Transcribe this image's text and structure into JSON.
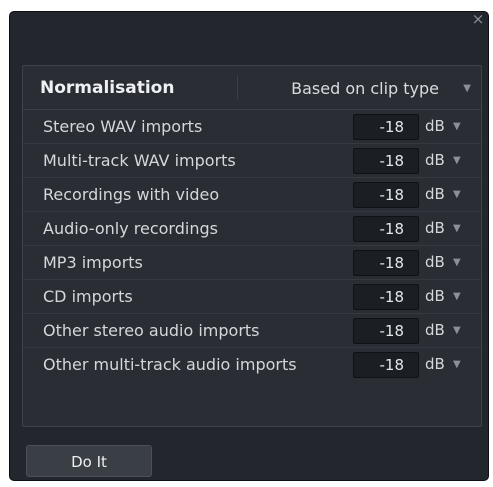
{
  "dialog": {
    "close_icon": "close-icon",
    "close_glyph": "×"
  },
  "normalisation": {
    "title": "Normalisation",
    "mode": "Based on clip type",
    "rows": [
      {
        "label": "Stereo WAV imports",
        "value": "-18",
        "unit": "dB"
      },
      {
        "label": "Multi-track WAV imports",
        "value": "-18",
        "unit": "dB"
      },
      {
        "label": "Recordings with video",
        "value": "-18",
        "unit": "dB"
      },
      {
        "label": "Audio-only recordings",
        "value": "-18",
        "unit": "dB"
      },
      {
        "label": "MP3 imports",
        "value": "-18",
        "unit": "dB"
      },
      {
        "label": "CD imports",
        "value": "-18",
        "unit": "dB"
      },
      {
        "label": "Other stereo audio imports",
        "value": "-18",
        "unit": "dB"
      },
      {
        "label": "Other multi-track audio imports",
        "value": "-18",
        "unit": "dB"
      }
    ]
  },
  "footer": {
    "do_it_label": "Do It"
  },
  "colors": {
    "dialog_bg": "#23272d",
    "panel_bg": "#2a2e34",
    "field_bg": "#1b1e22",
    "button_bg": "#3a3f46"
  }
}
